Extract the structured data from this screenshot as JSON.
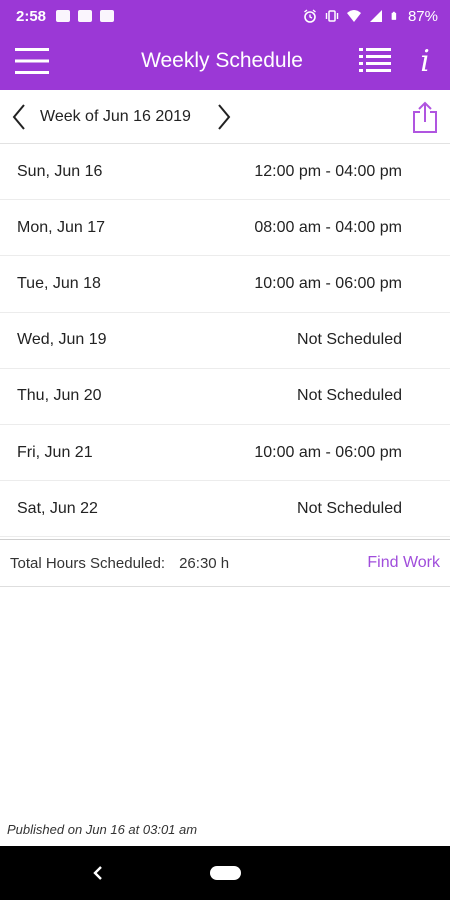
{
  "status_bar": {
    "time": "2:58",
    "battery": "87%",
    "icons": [
      "image-icon",
      "mail-icon",
      "mail-icon",
      "alarm-icon",
      "vibrate-icon",
      "wifi-icon",
      "signal-icon",
      "battery-icon"
    ]
  },
  "app_bar": {
    "title": "Weekly Schedule",
    "icons": [
      "menu-icon",
      "list-icon",
      "info-icon"
    ],
    "info_glyph": "i"
  },
  "week": {
    "label": "Week of Jun 16 2019",
    "icons": [
      "chevron-left-icon",
      "chevron-right-icon",
      "share-icon"
    ]
  },
  "schedule": [
    {
      "day": "Sun, Jun 16",
      "hours": "12:00 pm - 04:00 pm"
    },
    {
      "day": "Mon, Jun 17",
      "hours": "08:00 am - 04:00 pm"
    },
    {
      "day": "Tue, Jun 18",
      "hours": "10:00 am - 06:00 pm"
    },
    {
      "day": "Wed, Jun 19",
      "hours": "Not Scheduled"
    },
    {
      "day": "Thu, Jun 20",
      "hours": "Not Scheduled"
    },
    {
      "day": "Fri, Jun 21",
      "hours": "10:00 am - 06:00 pm"
    },
    {
      "day": "Sat, Jun 22",
      "hours": "Not Scheduled"
    }
  ],
  "summary": {
    "label": "Total Hours Scheduled:",
    "value": "26:30 h",
    "find_work": "Find Work"
  },
  "footer": {
    "published": "Published on Jun 16 at 03:01 am"
  },
  "colors": {
    "primary": "#9b38d6",
    "link": "#a04ddb",
    "share_icon": "#b055e0"
  },
  "nav_bar": {
    "icons": [
      "back-icon",
      "home-icon"
    ]
  }
}
